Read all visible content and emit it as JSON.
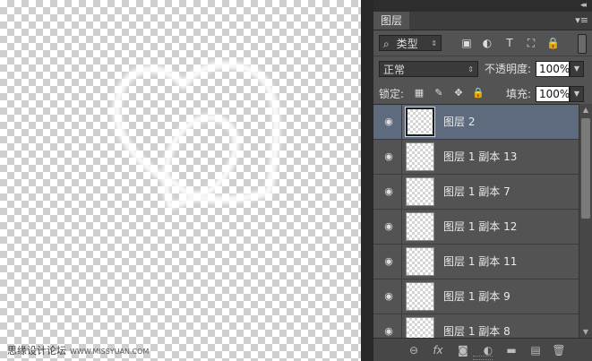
{
  "canvas": {
    "watermark": "思缘设计论坛",
    "watermark_url": "WWW.MISSYUAN.COM"
  },
  "panel": {
    "collapse_glyph": "◂◂",
    "tab_label": "图层",
    "menu_glyph": "▾≡",
    "filter": {
      "kind_glyph": "⌕",
      "kind_label": "类型",
      "arrow": "⇕"
    },
    "filter_icons": [
      "▣",
      "◐",
      "T",
      "⛶",
      "🔒"
    ],
    "blend_mode": "正常",
    "opacity_label": "不透明度:",
    "opacity_value": "100%",
    "lock_label": "锁定:",
    "lock_icons": [
      "▦",
      "✎",
      "✥",
      "🔒"
    ],
    "fill_label": "填充:",
    "fill_value": "100%",
    "layers": [
      {
        "name": "图层 2",
        "selected": true
      },
      {
        "name": "图层 1 副本 13",
        "selected": false
      },
      {
        "name": "图层 1 副本 7",
        "selected": false
      },
      {
        "name": "图层 1 副本 12",
        "selected": false
      },
      {
        "name": "图层 1 副本 11",
        "selected": false
      },
      {
        "name": "图层 1 副本 9",
        "selected": false
      },
      {
        "name": "图层 1 副本 8",
        "selected": false
      }
    ],
    "bottom_icons": [
      "⊖",
      "fx",
      "◙",
      "◐",
      "▬",
      "▤",
      "🗑"
    ]
  }
}
